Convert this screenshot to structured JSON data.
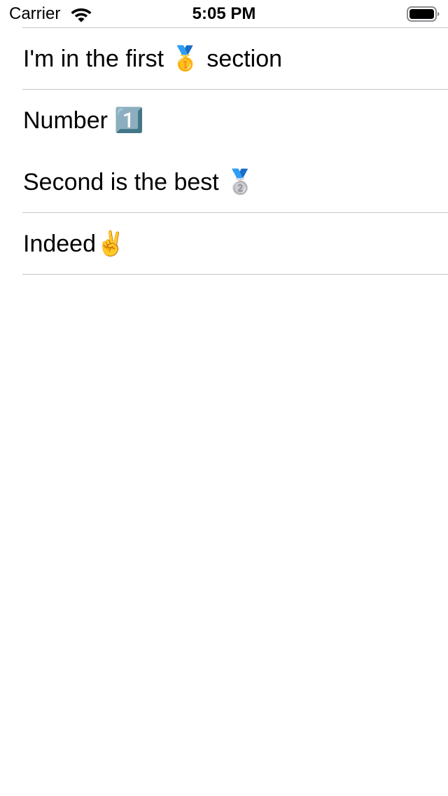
{
  "status_bar": {
    "carrier": "Carrier",
    "time": "5:05 PM"
  },
  "table": {
    "rows": [
      {
        "label": "I'm in the first 🥇 section",
        "separator_below": true
      },
      {
        "label": "Number 1️⃣",
        "separator_below": false
      },
      {
        "label": "Second is the best 🥈",
        "separator_below": true
      },
      {
        "label": "Indeed✌️",
        "separator_below": true
      }
    ]
  },
  "colors": {
    "background": "#ffffff",
    "text": "#000000",
    "separator": "#c6c6c8"
  },
  "icons": [
    "wifi-icon",
    "battery-icon"
  ]
}
